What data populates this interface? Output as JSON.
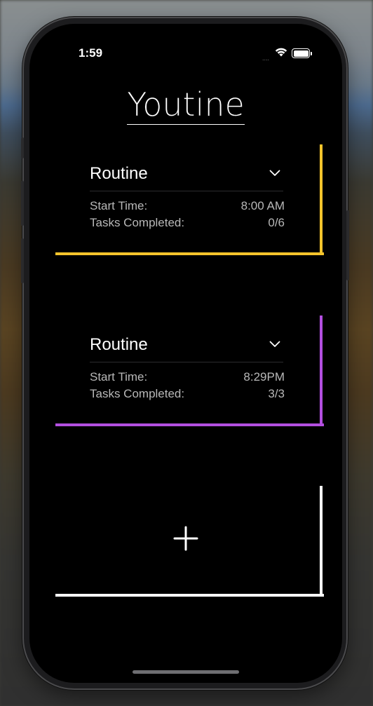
{
  "status_bar": {
    "time": "1:59",
    "signal": "....",
    "wifi_icon": "wifi-icon",
    "battery_icon": "battery-icon"
  },
  "app": {
    "title": "Youtine"
  },
  "routines": [
    {
      "name": "Routine",
      "accent_color": "#F5C42C",
      "start_time_label": "Start Time:",
      "start_time": "8:00 AM",
      "tasks_label": "Tasks Completed:",
      "tasks_completed": "0/6",
      "expand_icon": "chevron-down-icon"
    },
    {
      "name": "Routine",
      "accent_color": "#B34FE0",
      "start_time_label": "Start Time:",
      "start_time": "8:29PM",
      "tasks_label": "Tasks Completed:",
      "tasks_completed": "3/3",
      "expand_icon": "chevron-down-icon"
    }
  ],
  "add_routine": {
    "icon": "plus-icon",
    "accent_color": "#FFFFFF"
  }
}
